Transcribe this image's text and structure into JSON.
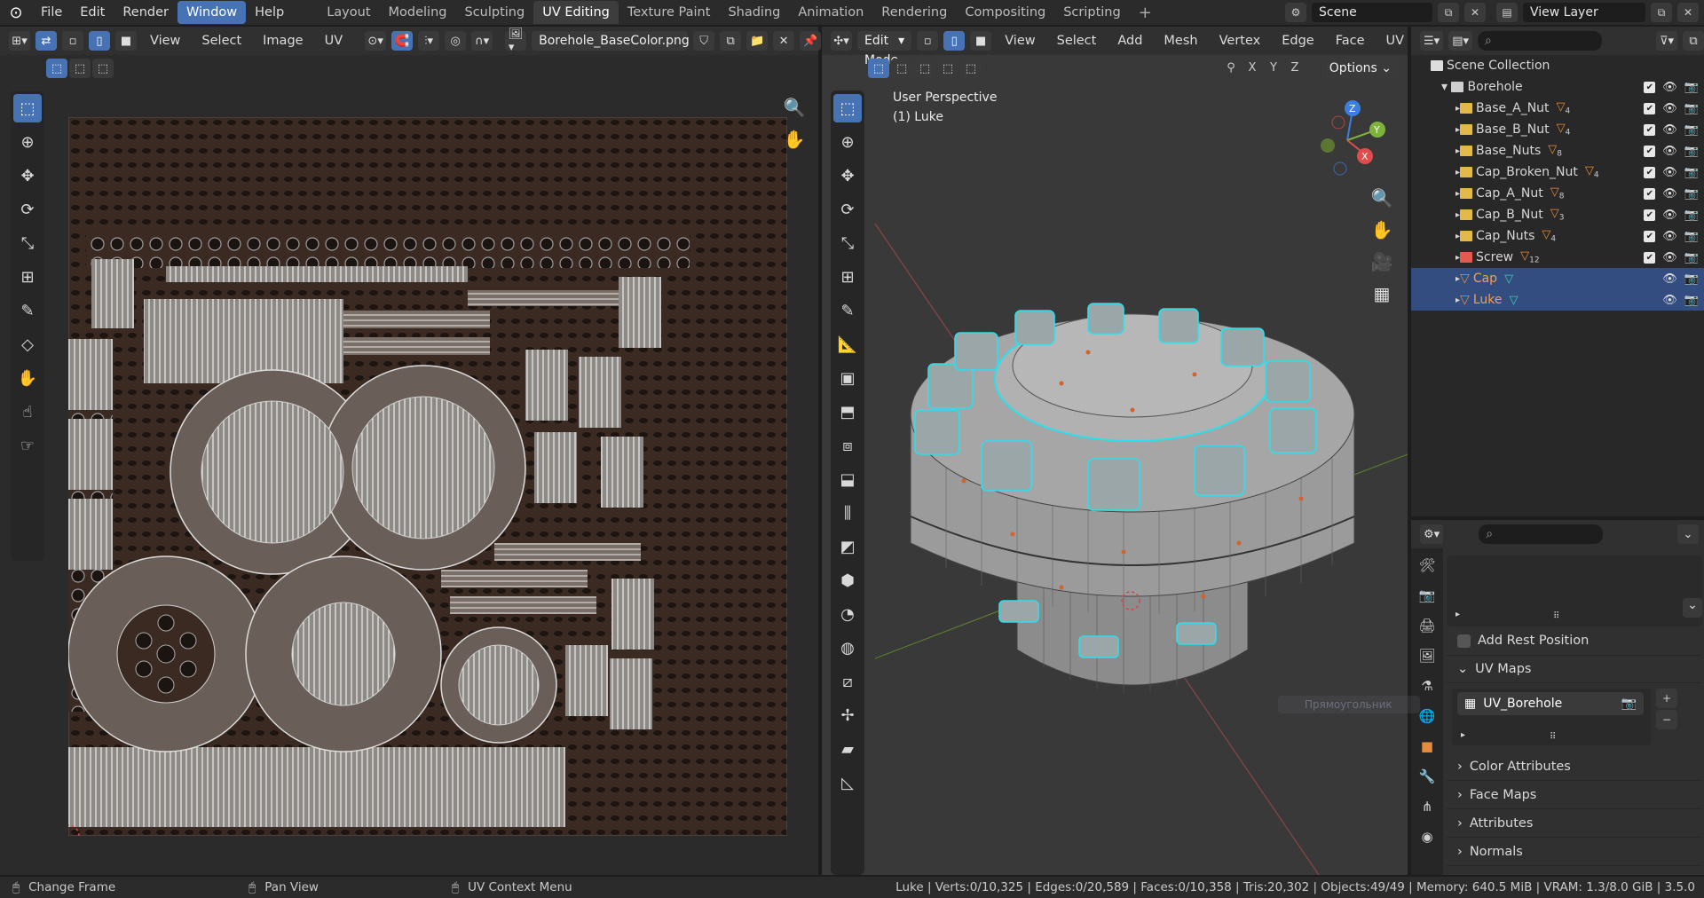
{
  "topbar": {
    "menus": [
      "File",
      "Edit",
      "Render",
      "Window",
      "Help"
    ],
    "active_menu": "Window",
    "workspaces": [
      "Layout",
      "Modeling",
      "Sculpting",
      "UV Editing",
      "Texture Paint",
      "Shading",
      "Animation",
      "Rendering",
      "Compositing",
      "Scripting"
    ],
    "active_workspace": "UV Editing",
    "add_tab": "+",
    "scene": "Scene",
    "view_layer": "View Layer"
  },
  "uv_editor": {
    "menus": [
      "View",
      "Select",
      "Image",
      "UV"
    ],
    "image_name": "Borehole_BaseColor.png"
  },
  "viewport": {
    "mode": "Edit Mode",
    "menus": [
      "View",
      "Select",
      "Add",
      "Mesh",
      "Vertex",
      "Edge",
      "Face",
      "UV"
    ],
    "view_label": "User Perspective",
    "object_label": "(1) Luke",
    "axes": [
      "X",
      "Y",
      "Z"
    ],
    "options": "Options",
    "gizmo": {
      "x": "X",
      "y": "Y",
      "z": "Z"
    },
    "colors": {
      "selected_edges": "#27e1ee",
      "background": "#393939"
    }
  },
  "outliner": {
    "scene_collection": "Scene Collection",
    "collection": "Borehole",
    "items": [
      {
        "name": "Base_A_Nut",
        "count": "4",
        "type": "collection"
      },
      {
        "name": "Base_B_Nut",
        "count": "4",
        "type": "collection"
      },
      {
        "name": "Base_Nuts",
        "count": "8",
        "type": "collection"
      },
      {
        "name": "Cap_Broken_Nut",
        "count": "4",
        "type": "collection"
      },
      {
        "name": "Cap_A_Nut",
        "count": "8",
        "type": "collection"
      },
      {
        "name": "Cap_B_Nut",
        "count": "3",
        "type": "collection"
      },
      {
        "name": "Cap_Nuts",
        "count": "4",
        "type": "collection"
      },
      {
        "name": "Screw",
        "count": "12",
        "type": "collection-red"
      },
      {
        "name": "Cap",
        "count": "",
        "type": "mesh-selected"
      },
      {
        "name": "Luke",
        "count": "",
        "type": "mesh-active"
      }
    ]
  },
  "properties": {
    "add_rest_position": "Add Rest Position",
    "uv_maps": "UV Maps",
    "uv_map_name": "UV_Borehole",
    "sections": [
      "Color Attributes",
      "Face Maps",
      "Attributes",
      "Normals"
    ],
    "ghost_tooltip": "Прямоугольник"
  },
  "statusbar": {
    "left": [
      {
        "icon": "mouse-left-icon",
        "label": "Change Frame"
      },
      {
        "icon": "mouse-middle-icon",
        "label": "Pan View"
      },
      {
        "icon": "mouse-right-icon",
        "label": "UV Context Menu"
      }
    ],
    "stats": "Luke | Verts:0/10,325 | Edges:0/20,589 | Faces:0/10,358 | Tris:20,302 | Objects:49/49 | Memory: 640.5 MiB | VRAM: 1.3/8.0 GiB | 3.5.0"
  }
}
